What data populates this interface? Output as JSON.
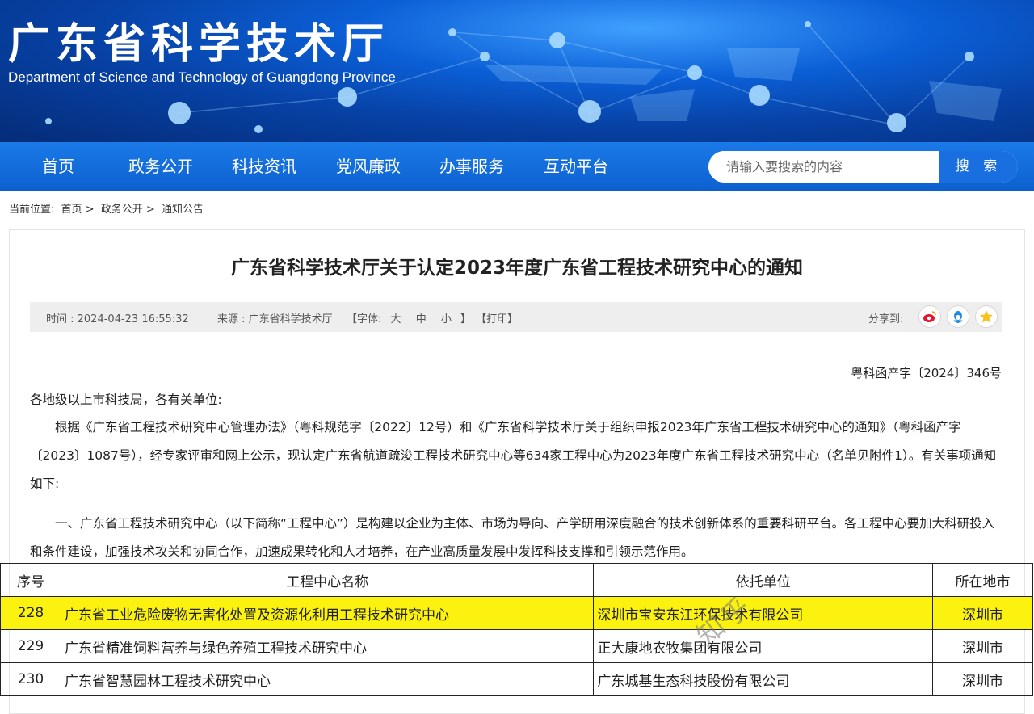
{
  "header": {
    "title": "广东省科学技术厅",
    "subtitle": "Department of Science and Technology of Guangdong Province"
  },
  "nav": {
    "items": [
      "首页",
      "政务公开",
      "科技资讯",
      "党风廉政",
      "办事服务",
      "互动平台"
    ],
    "search_placeholder": "请输入要搜索的内容",
    "search_button": "搜 索"
  },
  "breadcrumb": {
    "prefix": "当前位置:",
    "items": [
      "首页",
      "政务公开",
      "通知公告"
    ],
    "separator": ">"
  },
  "article": {
    "title": "广东省科学技术厅关于认定2023年度广东省工程技术研究中心的通知",
    "time": "时间 : 2024-04-23 16:55:32",
    "source": "来源 : 广东省科学技术厅",
    "font_size_label": "【字体:",
    "font_large": "大",
    "font_medium": "中",
    "font_small": "小",
    "font_close": "】",
    "print": "【打印】",
    "share_label": "分享到:",
    "share_icons": [
      "weibo-icon",
      "qq-icon",
      "qzone-icon"
    ],
    "doc_number": "粤科函产字〔2024〕346号",
    "salutation": "各地级以上市科技局，各有关单位:",
    "para1": "根据《广东省工程技术研究中心管理办法》（粤科规范字〔2022〕12号）和《广东省科学技术厅关于组织申报2023年广东省工程技术研究中心的通知》（粤科函产字〔2023〕1087号），经专家评审和网上公示，现认定广东省航道疏浚工程技术研究中心等634家工程中心为2023年度广东省工程技术研究中心（名单见附件1）。有关事项通知如下:",
    "para2": "一、广东省工程技术研究中心（以下简称“工程中心”）是构建以企业为主体、市场为导向、产学研用深度融合的技术创新体系的重要科研平台。各工程中心要加大科研投入和条件建设，加强技术攻关和协同合作，加速成果转化和人才培养，在产业高质量发展中发挥科技支撑和引领示范作用。"
  },
  "table": {
    "headers": [
      "序号",
      "工程中心名称",
      "依托单位",
      "所在地市"
    ],
    "rows": [
      [
        "228",
        "广东省工业危险废物无害化处置及资源化利用工程技术研究中心",
        "深圳市宝安东江环保技术有限公司",
        "深圳市"
      ],
      [
        "229",
        "广东省精准饲料营养与绿色养殖工程技术研究中心",
        "正大康地农牧集团有限公司",
        "深圳市"
      ],
      [
        "230",
        "广东省智慧园林工程技术研究中心",
        "广东城基生态科技股份有限公司",
        "深圳市"
      ]
    ],
    "highlight_row": 0,
    "highlight_color": "#fbf20f"
  },
  "watermark": "知乎"
}
